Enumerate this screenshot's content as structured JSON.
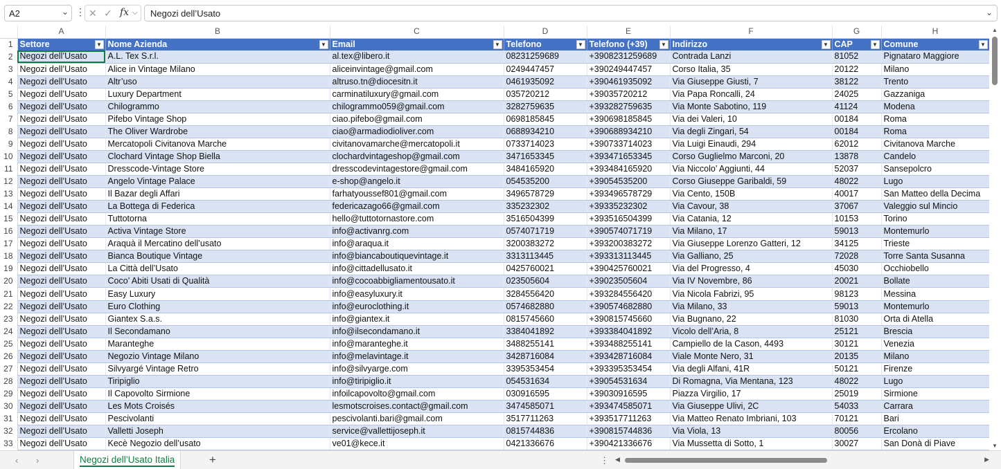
{
  "formula_bar": {
    "name_box": "A2",
    "formula": "Negozi dell’Usato",
    "fx_label": "fx"
  },
  "grid": {
    "column_letters": [
      "A",
      "B",
      "C",
      "D",
      "E",
      "F",
      "G",
      "H"
    ],
    "headers": [
      "Settore",
      "Nome Azienda",
      "Email",
      "Telefono",
      "Telefono (+39)",
      "Indirizzo",
      "CAP",
      "Comune"
    ],
    "rows": [
      {
        "n": "2",
        "cells": [
          "Negozi dell’Usato",
          "A.L. Tex S.r.l.",
          "al.tex@libero.it",
          "08231259689",
          "+3908231259689",
          "Contrada Lanzi",
          "81052",
          "Pignataro Maggiore"
        ]
      },
      {
        "n": "3",
        "cells": [
          "Negozi dell’Usato",
          "Alice in Vintage Milano",
          "aliceinvintage@gmail.com",
          "0249447457",
          "+390249447457",
          "Corso Italia, 35",
          "20122",
          "Milano"
        ]
      },
      {
        "n": "4",
        "cells": [
          "Negozi dell’Usato",
          "Altr’uso",
          "altruso.tn@diocesitn.it",
          "0461935092",
          "+390461935092",
          "Via Giuseppe Giusti, 7",
          "38122",
          "Trento"
        ]
      },
      {
        "n": "5",
        "cells": [
          "Negozi dell’Usato",
          "Luxury Department",
          "carminatiluxury@gmail.com",
          "035720212",
          "+39035720212",
          "Via Papa Roncalli, 24",
          "24025",
          "Gazzaniga"
        ]
      },
      {
        "n": "6",
        "cells": [
          "Negozi dell’Usato",
          "Chilogrammo",
          "chilogrammo059@gmail.com",
          "3282759635",
          "+393282759635",
          "Via Monte Sabotino, 119",
          "41124",
          "Modena"
        ]
      },
      {
        "n": "7",
        "cells": [
          "Negozi dell’Usato",
          "Pifebo Vintage Shop",
          "ciao.pifebo@gmail.com",
          "0698185845",
          "+390698185845",
          "Via dei Valeri, 10",
          "00184",
          "Roma"
        ]
      },
      {
        "n": "8",
        "cells": [
          "Negozi dell’Usato",
          "The Oliver Wardrobe",
          "ciao@armadiodioliver.com",
          "0688934210",
          "+390688934210",
          "Via degli Zingari, 54",
          "00184",
          "Roma"
        ]
      },
      {
        "n": "9",
        "cells": [
          "Negozi dell’Usato",
          "Mercatopoli Civitanova Marche",
          "civitanovamarche@mercatopoli.it",
          "0733714023",
          "+390733714023",
          "Via Luigi Einaudi, 294",
          "62012",
          "Civitanova Marche"
        ]
      },
      {
        "n": "10",
        "cells": [
          "Negozi dell’Usato",
          "Clochard Vintage Shop Biella",
          "clochardvintageshop@gmail.com",
          "3471653345",
          "+393471653345",
          "Corso Guglielmo Marconi, 20",
          "13878",
          "Candelo"
        ]
      },
      {
        "n": "11",
        "cells": [
          "Negozi dell’Usato",
          "Dresscode-Vintage Store",
          "dresscodevintagestore@gmail.com",
          "3484165920",
          "+393484165920",
          "Via Niccolo’ Aggiunti, 44",
          "52037",
          "Sansepolcro"
        ]
      },
      {
        "n": "12",
        "cells": [
          "Negozi dell’Usato",
          "Angelo Vintage Palace",
          "e-shop@angelo.it",
          "054535200",
          "+39054535200",
          "Corso Giuseppe Garibaldi, 59",
          "48022",
          "Lugo"
        ]
      },
      {
        "n": "13",
        "cells": [
          "Negozi dell’Usato",
          "Il Bazar degli Affari",
          "farhatyoussef801@gmail.com",
          "3496578729",
          "+393496578729",
          "Via Cento, 150B",
          "40017",
          "San Matteo della Decima"
        ]
      },
      {
        "n": "14",
        "cells": [
          "Negozi dell’Usato",
          "La Bottega di Federica",
          "federicazago66@gmail.com",
          "335232302",
          "+39335232302",
          "Via Cavour, 38",
          "37067",
          "Valeggio sul Mincio"
        ]
      },
      {
        "n": "15",
        "cells": [
          "Negozi dell’Usato",
          "Tuttotorna",
          "hello@tuttotornastore.com",
          "3516504399",
          "+393516504399",
          "Via Catania, 12",
          "10153",
          "Torino"
        ]
      },
      {
        "n": "16",
        "cells": [
          "Negozi dell’Usato",
          "Activa Vintage Store",
          "info@activanrg.com",
          "0574071719",
          "+390574071719",
          "Via Milano, 17",
          "59013",
          "Montemurlo"
        ]
      },
      {
        "n": "17",
        "cells": [
          "Negozi dell’Usato",
          "Araquà il Mercatino dell’usato",
          "info@araqua.it",
          "3200383272",
          "+393200383272",
          "Via Giuseppe Lorenzo Gatteri, 12",
          "34125",
          "Trieste"
        ]
      },
      {
        "n": "18",
        "cells": [
          "Negozi dell’Usato",
          "Bianca Boutique Vintage",
          "info@biancaboutiquevintage.it",
          "3313113445",
          "+393313113445",
          "Via Galliano, 25",
          "72028",
          "Torre Santa Susanna"
        ]
      },
      {
        "n": "19",
        "cells": [
          "Negozi dell’Usato",
          "La Città dell’Usato",
          "info@cittadellusato.it",
          "0425760021",
          "+390425760021",
          "Via del Progresso, 4",
          "45030",
          "Occhiobello"
        ]
      },
      {
        "n": "20",
        "cells": [
          "Negozi dell’Usato",
          "Coco’ Abiti Usati di Qualità",
          "info@cocoabbigliamentousato.it",
          "023505604",
          "+39023505604",
          "Via IV Novembre, 86",
          "20021",
          "Bollate"
        ]
      },
      {
        "n": "21",
        "cells": [
          "Negozi dell’Usato",
          "Easy Luxury",
          "info@easyluxury.it",
          "3284556420",
          "+393284556420",
          "Via Nicola Fabrizi, 95",
          "98123",
          "Messina"
        ]
      },
      {
        "n": "22",
        "cells": [
          "Negozi dell’Usato",
          "Euro Clothing",
          "info@euroclothing.it",
          "0574682880",
          "+390574682880",
          "Via Milano, 33",
          "59013",
          "Montemurlo"
        ]
      },
      {
        "n": "23",
        "cells": [
          "Negozi dell’Usato",
          "Giantex S.a.s.",
          "info@giantex.it",
          "0815745660",
          "+390815745660",
          "Via Bugnano, 22",
          "81030",
          "Orta di Atella"
        ]
      },
      {
        "n": "24",
        "cells": [
          "Negozi dell’Usato",
          "Il Secondamano",
          "info@ilsecondamano.it",
          "3384041892",
          "+393384041892",
          "Vicolo dell’Aria, 8",
          "25121",
          "Brescia"
        ]
      },
      {
        "n": "25",
        "cells": [
          "Negozi dell’Usato",
          "Maranteghe",
          "info@maranteghe.it",
          "3488255141",
          "+393488255141",
          "Campiello de la Cason, 4493",
          "30121",
          "Venezia"
        ]
      },
      {
        "n": "26",
        "cells": [
          "Negozi dell’Usato",
          "Negozio Vintage Milano",
          "info@melavintage.it",
          "3428716084",
          "+393428716084",
          "Viale Monte Nero, 31",
          "20135",
          "Milano"
        ]
      },
      {
        "n": "27",
        "cells": [
          "Negozi dell’Usato",
          "Silvyargé Vintage Retro",
          "info@silvyarge.com",
          "3395353454",
          "+393395353454",
          "Via degli Alfani, 41R",
          "50121",
          "Firenze"
        ]
      },
      {
        "n": "28",
        "cells": [
          "Negozi dell’Usato",
          "Tiripiglio",
          "info@tiripiglio.it",
          "054531634",
          "+39054531634",
          "Di Romagna, Via Mentana, 123",
          "48022",
          "Lugo"
        ]
      },
      {
        "n": "29",
        "cells": [
          "Negozi dell’Usato",
          "Il Capovolto Sirmione",
          "infoilcapovolto@gmail.com",
          "030916595",
          "+39030916595",
          "Piazza Virgilio, 17",
          "25019",
          "Sirmione"
        ]
      },
      {
        "n": "30",
        "cells": [
          "Negozi dell’Usato",
          "Les Mots Croisés",
          "lesmotscroises.contact@gmail.com",
          "3474585071",
          "+393474585071",
          "Via Giuseppe Ulivi, 2C",
          "54033",
          "Carrara"
        ]
      },
      {
        "n": "31",
        "cells": [
          "Negozi dell’Usato",
          "Pescivolanti",
          "pescivolanti.bari@gmail.com",
          "3517711263",
          "+393517711263",
          "Via Matteo Renato Imbriani, 103",
          "70121",
          "Bari"
        ]
      },
      {
        "n": "32",
        "cells": [
          "Negozi dell’Usato",
          "Valletti Joseph",
          "service@vallettijoseph.it",
          "0815744836",
          "+390815744836",
          "Via Viola, 13",
          "80056",
          "Ercolano"
        ]
      },
      {
        "n": "33",
        "cells": [
          "Negozi dell’Usato",
          "Kecè Negozio dell’usato",
          "ve01@kece.it",
          "0421336676",
          "+390421336676",
          "Via Mussetta di Sotto, 1",
          "30027",
          "San Donà di Piave"
        ]
      }
    ]
  },
  "sheet_tabs": [
    "Negozi dell’Usato Italia"
  ],
  "colors": {
    "header_fill": "#4472c4",
    "band_fill": "#dae3f3",
    "accent": "#107c41"
  },
  "icons": {
    "name_box_dropdown": "chevron-down-icon",
    "cancel": "close-icon",
    "confirm": "check-icon",
    "function": "fx-icon",
    "filter": "filter-dropdown-icon",
    "add_sheet": "plus-icon"
  }
}
